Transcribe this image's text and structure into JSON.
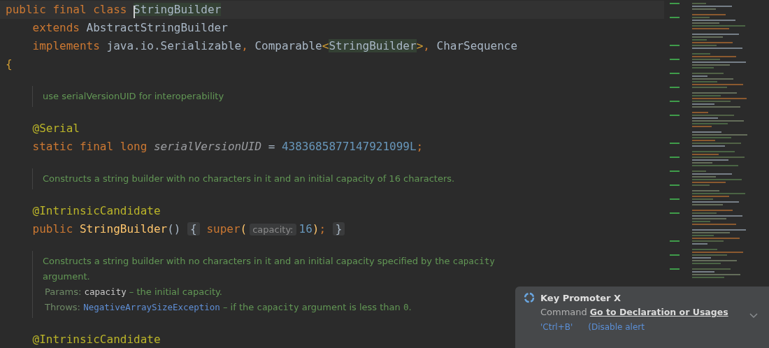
{
  "editor": {
    "lines": [
      {
        "kind": "code",
        "tokens": [
          {
            "kind": "keyword",
            "text": "public final class "
          },
          {
            "kind": "highlight",
            "text": "StringBuilder",
            "caret": true
          }
        ]
      },
      {
        "kind": "code",
        "tokens": [
          {
            "kind": "keyword",
            "text": "    extends "
          },
          {
            "kind": "plain",
            "text": "AbstractStringBuilder"
          }
        ]
      },
      {
        "kind": "code",
        "tokens": [
          {
            "kind": "keyword",
            "text": "    implements "
          },
          {
            "kind": "plain",
            "text": "java.io.Serializable"
          },
          {
            "kind": "keyword",
            "text": ", "
          },
          {
            "kind": "plain",
            "text": "Comparable"
          },
          {
            "kind": "bracket",
            "text": "<"
          },
          {
            "kind": "highlight",
            "text": "StringBuilder"
          },
          {
            "kind": "bracket",
            "text": ">"
          },
          {
            "kind": "keyword",
            "text": ", "
          },
          {
            "kind": "plain",
            "text": "CharSequence"
          }
        ]
      },
      {
        "kind": "code",
        "tokens": [
          {
            "kind": "bracket",
            "text": "{"
          }
        ]
      },
      {
        "kind": "doc",
        "rows": [
          {
            "tokens": [
              {
                "kind": "text",
                "text": "use serialVersionUID for interoperability"
              }
            ]
          }
        ]
      },
      {
        "kind": "code",
        "tokens": [
          {
            "kind": "annotation",
            "text": "    @Serial"
          }
        ]
      },
      {
        "kind": "code",
        "tokens": [
          {
            "kind": "keyword",
            "text": "    static final long "
          },
          {
            "kind": "field",
            "text": "serialVersionUID"
          },
          {
            "kind": "plain",
            "text": " = "
          },
          {
            "kind": "number",
            "text": "4383685877147921099L"
          },
          {
            "kind": "keyword",
            "text": ";"
          }
        ]
      },
      {
        "kind": "doc",
        "rows": [
          {
            "tokens": [
              {
                "kind": "text",
                "text": "Constructs a string builder with no characters in it and an initial capacity of 16 characters."
              }
            ]
          }
        ]
      },
      {
        "kind": "code",
        "tokens": [
          {
            "kind": "annotation",
            "text": "    @IntrinsicCandidate"
          }
        ]
      },
      {
        "kind": "code",
        "tokens": [
          {
            "kind": "keyword",
            "text": "    public "
          },
          {
            "kind": "method",
            "text": "StringBuilder"
          },
          {
            "kind": "plain",
            "text": "() "
          },
          {
            "kind": "fold",
            "text": "{"
          },
          {
            "kind": "keyword",
            "text": " super"
          },
          {
            "kind": "method",
            "text": "("
          },
          {
            "kind": "hint",
            "text": "capacity:"
          },
          {
            "kind": "number",
            "text": "16"
          },
          {
            "kind": "method",
            "text": ")"
          },
          {
            "kind": "keyword",
            "text": "; "
          },
          {
            "kind": "fold",
            "text": "}"
          }
        ]
      },
      {
        "kind": "doc",
        "rows": [
          {
            "tokens": [
              {
                "kind": "text",
                "text": "Constructs a string builder with no characters in it and an initial capacity specified by the "
              },
              {
                "kind": "code",
                "text": "capacity"
              },
              {
                "kind": "text",
                "text": " argument."
              }
            ]
          },
          {
            "tokens": [
              {
                "kind": "label",
                "text": "Params: "
              },
              {
                "kind": "param",
                "text": "capacity"
              },
              {
                "kind": "text",
                "text": " – the initial capacity."
              }
            ]
          },
          {
            "tokens": [
              {
                "kind": "label",
                "text": "Throws: "
              },
              {
                "kind": "link",
                "text": "NegativeArraySizeException"
              },
              {
                "kind": "text",
                "text": " – if the "
              },
              {
                "kind": "code",
                "text": "capacity"
              },
              {
                "kind": "text",
                "text": " argument is less than "
              },
              {
                "kind": "code",
                "text": "0"
              },
              {
                "kind": "text",
                "text": "."
              }
            ]
          }
        ]
      },
      {
        "kind": "code",
        "tokens": [
          {
            "kind": "annotation",
            "text": "    @IntrinsicCandidate"
          }
        ]
      }
    ]
  },
  "notification": {
    "title": "Key Promoter X",
    "message_prefix": "Command",
    "message_link": "Go to Declaration or Usages",
    "shortcut": "'Ctrl+B'",
    "action": "(Disable alert"
  }
}
